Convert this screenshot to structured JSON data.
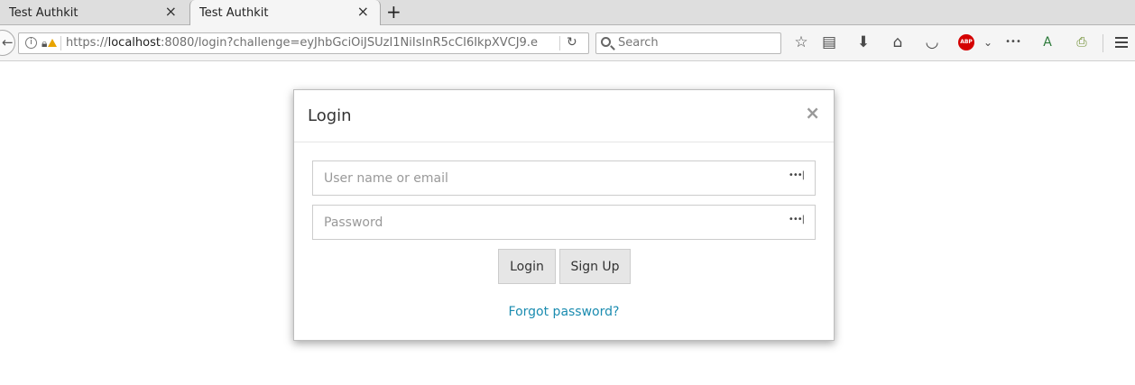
{
  "browser": {
    "tabs": [
      {
        "title": "Test Authkit",
        "close": "×"
      },
      {
        "title": "Test Authkit",
        "close": "×"
      }
    ],
    "new_tab_label": "+",
    "url": {
      "scheme": "https://",
      "host": "localhost",
      "rest": ":8080/login?challenge=eyJhbGciOiJSUzI1NiIsInR5cCI6IkpXVCJ9.e"
    },
    "search_placeholder": "Search",
    "toolbar_icons": [
      "star-icon",
      "reading-list-icon",
      "download-icon",
      "home-icon",
      "pocket-icon",
      "abp-icon",
      "chevron-down-icon",
      "overflow-icon",
      "translate-icon",
      "print-icon",
      "menu-icon"
    ],
    "abp_label": "ABP"
  },
  "modal": {
    "title": "Login",
    "close": "×",
    "username_placeholder": "User name or email",
    "password_placeholder": "Password",
    "login_button": "Login",
    "signup_button": "Sign Up",
    "forgot_link": "Forgot password?"
  },
  "colors": {
    "link": "#1b8cb0",
    "abp": "#d40000",
    "warning": "#e8a400"
  }
}
